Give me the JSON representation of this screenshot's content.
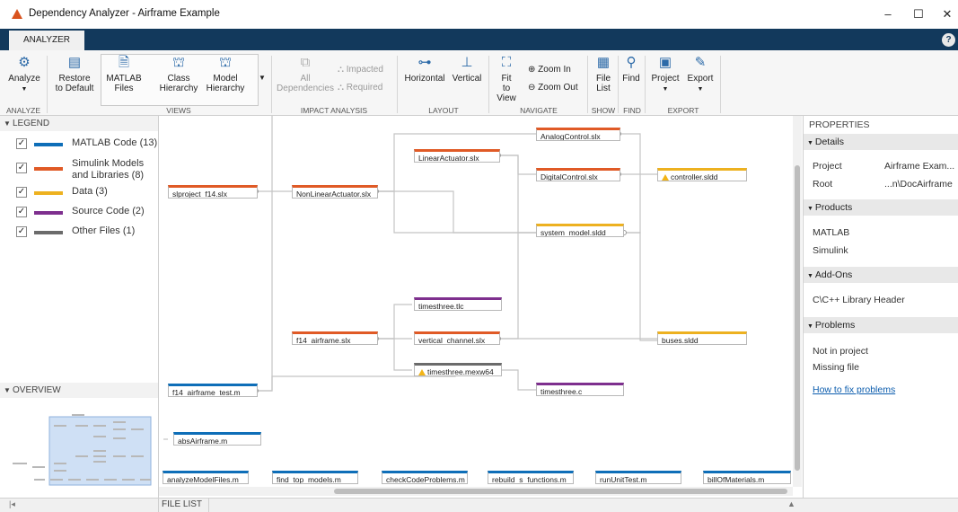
{
  "window": {
    "title": "Dependency Analyzer - Airframe Example",
    "minimize": "–",
    "maximize": "☐",
    "close": "✕"
  },
  "ribbon": {
    "tab": "ANALYZER",
    "help": "?",
    "buttons": {
      "analyze": "Analyze",
      "restore1": "Restore",
      "restore2": "to Default",
      "matlab1": "MATLAB",
      "matlab2": "Files",
      "class1": "Class",
      "class2": "Hierarchy",
      "model1": "Model",
      "model2": "Hierarchy",
      "alldep1": "All",
      "alldep2": "Dependencies",
      "impacted": "Impacted",
      "required": "Required",
      "horizontal": "Horizontal",
      "vertical": "Vertical",
      "fit1": "Fit",
      "fit2": "to View",
      "zoomin": "Zoom In",
      "zoomout": "Zoom Out",
      "filelist1": "File",
      "filelist2": "List",
      "find": "Find",
      "project": "Project",
      "export": "Export"
    },
    "groups": {
      "analyze": "ANALYZE",
      "views": "VIEWS",
      "impact": "IMPACT ANALYSIS",
      "layout": "LAYOUT",
      "navigate": "NAVIGATE",
      "show": "SHOW",
      "find": "FIND",
      "export": "EXPORT"
    }
  },
  "legend": {
    "title": "LEGEND",
    "items": [
      {
        "label": "MATLAB Code (13)",
        "color": "#0e6eb8"
      },
      {
        "label": "Simulink Models",
        "label2": "and Libraries (8)",
        "color": "#e05a26"
      },
      {
        "label": "Data (3)",
        "color": "#edb120"
      },
      {
        "label": "Source Code (2)",
        "color": "#7e2f8e"
      },
      {
        "label": "Other Files (1)",
        "color": "#6b6b6b"
      }
    ]
  },
  "overview": {
    "title": "OVERVIEW"
  },
  "graph": {
    "nodes": {
      "slproject": "slproject_f14.slx",
      "nonlinear": "NonLinearActuator.slx",
      "linear": "LinearActuator.slx",
      "analog": "AnalogControl.slx",
      "digital": "DigitalControl.slx",
      "controller": "controller.sldd",
      "system": "system_model.sldd",
      "timesthree_tlc": "timesthree.tlc",
      "f14": "f14_airframe.slx",
      "vertical": "vertical_channel.slx",
      "buses": "buses.sldd",
      "mexw": "timesthree.mexw64",
      "timesthree_c": "timesthree.c",
      "f14test": "f14_airframe_test.m",
      "absAirframe": "absAirframe.m",
      "analyzeModel": "analyzeModelFiles.m",
      "findTop": "find_top_models.m",
      "checkCode": "checkCodeProblems.m",
      "rebuild": "rebuild_s_functions.m",
      "runUnit": "runUnitTest.m",
      "bill": "billOfMaterials.m"
    }
  },
  "properties": {
    "title": "PROPERTIES",
    "details": {
      "header": "Details",
      "project_k": "Project",
      "project_v": "Airframe Exam...",
      "root_k": "Root",
      "root_v": "...n\\DocAirframe"
    },
    "products": {
      "header": "Products",
      "items": [
        "MATLAB",
        "Simulink"
      ]
    },
    "addons": {
      "header": "Add-Ons",
      "items": [
        "C\\C++ Library Header"
      ]
    },
    "problems": {
      "header": "Problems",
      "items": [
        "Not in project",
        "Missing file"
      ],
      "link": "How to fix problems"
    }
  },
  "footer": {
    "file_list": "FILE LIST",
    "left_marker": "|◂"
  }
}
